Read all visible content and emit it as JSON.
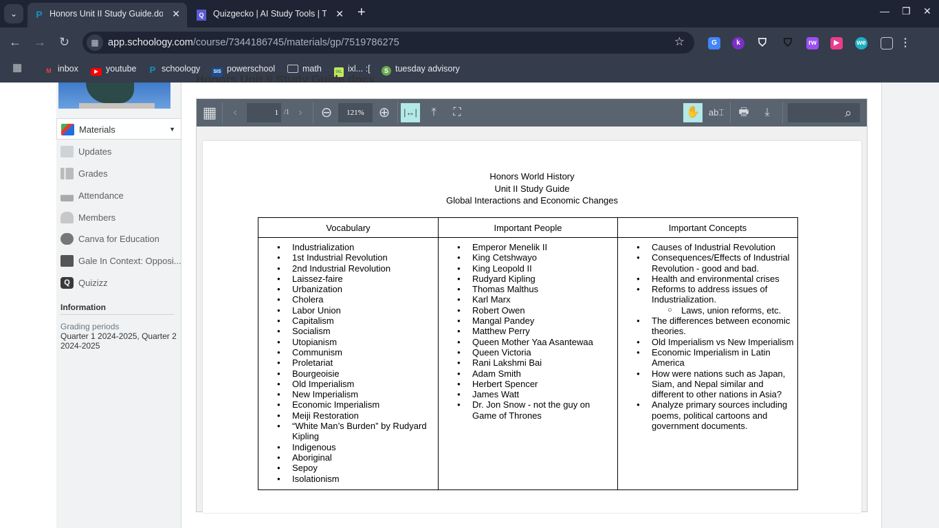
{
  "browser": {
    "tabs": [
      {
        "title": "Honors Unit II Study Guide.docx",
        "active": true,
        "favicon": "schoology-icon"
      },
      {
        "title": "Quizgecko | AI Study Tools | Test",
        "active": false,
        "favicon": "quizgecko-icon"
      }
    ],
    "url_host": "app.schoology.com",
    "url_path": "/course/7344186745/materials/gp/7519786275",
    "bookmarks": [
      "inbox",
      "youtube",
      "schoology",
      "powerschool",
      "math",
      "ixl... :[",
      "tuesday advisory"
    ],
    "extensions": [
      "google-translate",
      "kami",
      "shield",
      "shield-dark",
      "rw",
      "screencastify",
      "wevideo",
      "extensions"
    ]
  },
  "sidebar": {
    "items": [
      {
        "label": "Materials",
        "active": true
      },
      {
        "label": "Updates"
      },
      {
        "label": "Grades"
      },
      {
        "label": "Attendance"
      },
      {
        "label": "Members"
      },
      {
        "label": "Canva for Education"
      },
      {
        "label": "Gale In Context: Opposi..."
      },
      {
        "label": "Quizizz"
      }
    ],
    "info_heading": "Information",
    "grading_label": "Grading periods",
    "grading_value": "Quarter 1 2024-2025, Quarter 2 2024-2025"
  },
  "page_title": "Honors Unit II Study Guide.docx",
  "viewer": {
    "page": "1",
    "page_total": "/1",
    "zoom": "121%",
    "search_placeholder": ""
  },
  "document": {
    "title_lines": [
      "Honors World History",
      "Unit II Study Guide",
      "Global Interactions and Economic Changes"
    ],
    "headers": [
      "Vocabulary",
      "Important People",
      "Important Concepts"
    ],
    "vocabulary": [
      "Industrialization",
      "1st Industrial Revolution",
      "2nd Industrial Revolution",
      "Laissez-faire",
      "Urbanization",
      "Cholera",
      "Labor Union",
      "Capitalism",
      "Socialism",
      "Utopianism",
      "Communism",
      "Proletariat",
      "Bourgeoisie",
      "Old Imperialism",
      "New Imperialism",
      "Economic Imperialism",
      "Meiji Restoration",
      "“White Man’s Burden” by Rudyard Kipling",
      "Indigenous",
      "Aboriginal",
      "Sepoy",
      "Isolationism"
    ],
    "people": [
      "Emperor Menelik II",
      "King Cetshwayo",
      "King Leopold II",
      "Rudyard Kipling",
      "Thomas Malthus",
      "Karl Marx",
      "Robert Owen",
      "Mangal Pandey",
      "Matthew Perry",
      "Queen Mother Yaa Asantewaa",
      "Queen Victoria",
      "Rani Lakshmi Bai",
      "Adam Smith",
      "Herbert Spencer",
      "James Watt",
      "Dr. Jon Snow - not the guy on Game of Thrones"
    ],
    "concepts": [
      {
        "text": "Causes of Industrial Revolution"
      },
      {
        "text": "Consequences/Effects of Industrial Revolution - good and bad."
      },
      {
        "text": "Health and environmental crises"
      },
      {
        "text": "Reforms to address issues of Industrialization."
      },
      {
        "text": "Laws, union reforms, etc.",
        "sub": true
      },
      {
        "text": "The differences between economic theories."
      },
      {
        "text": "Old Imperialism vs New Imperialism"
      },
      {
        "text": "Economic Imperialism in Latin America"
      },
      {
        "text": "How were nations such as Japan, Siam, and Nepal similar and different to other nations in Asia?"
      },
      {
        "text": "Analyze primary sources including poems, political cartoons and government documents."
      }
    ]
  }
}
